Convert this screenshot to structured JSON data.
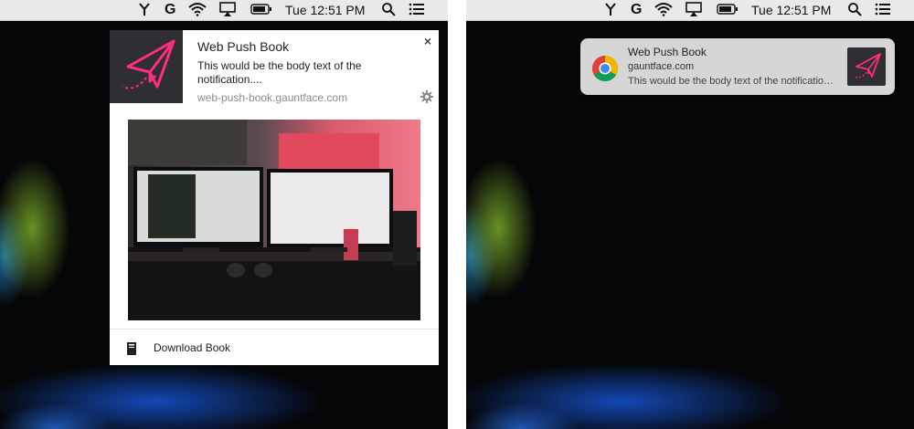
{
  "menubar": {
    "clock": "Tue 12:51 PM",
    "grammarly_letter": "G",
    "icons": [
      "app-fork-icon",
      "grammarly-icon",
      "wifi-icon",
      "airplay-icon",
      "battery-icon",
      "spotlight-search-icon",
      "notification-center-icon"
    ]
  },
  "chrome_notification": {
    "title": "Web Push Book",
    "body": "This would be the body text of the notification....",
    "origin": "web-push-book.gauntface.com",
    "close_glyph": "×",
    "action_label": "Download Book",
    "icon": "paper-plane-icon",
    "icon_color": "#ff2d7a",
    "image": "desk-monitors-photo"
  },
  "mac_notification": {
    "title": "Web Push Book",
    "site": "gauntface.com",
    "body": "This would be the body text of the notification....",
    "app_icon": "chrome-icon",
    "thumbnail": "paper-plane-icon"
  },
  "colors": {
    "menubar": "#e9e9e9",
    "desktop": "#050608",
    "accent_pink": "#ff2d7a",
    "banner": "#d6d6d6"
  }
}
